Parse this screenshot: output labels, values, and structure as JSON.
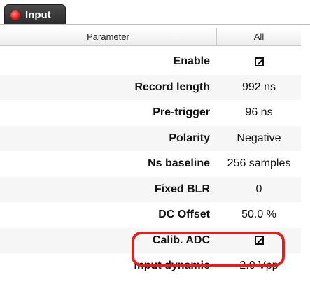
{
  "tab": {
    "label": "Input",
    "icon": "red-status-dot-icon"
  },
  "table": {
    "headers": {
      "parameter": "Parameter",
      "all": "All"
    },
    "rows": [
      {
        "label": "Enable",
        "value": "",
        "checkbox": true
      },
      {
        "label": "Record length",
        "value": "992 ns"
      },
      {
        "label": "Pre-trigger",
        "value": "96 ns"
      },
      {
        "label": "Polarity",
        "value": "Negative"
      },
      {
        "label": "Ns baseline",
        "value": "256 samples"
      },
      {
        "label": "Fixed BLR",
        "value": "0"
      },
      {
        "label": "DC Offset",
        "value": "50.0 %"
      },
      {
        "label": "Calib. ADC",
        "value": "",
        "checkbox": true
      },
      {
        "label": "Input dynamic",
        "value": "2.0 Vpp"
      }
    ]
  },
  "colors": {
    "highlight": "#e02020",
    "tab_bg": "#2b2b2b"
  }
}
